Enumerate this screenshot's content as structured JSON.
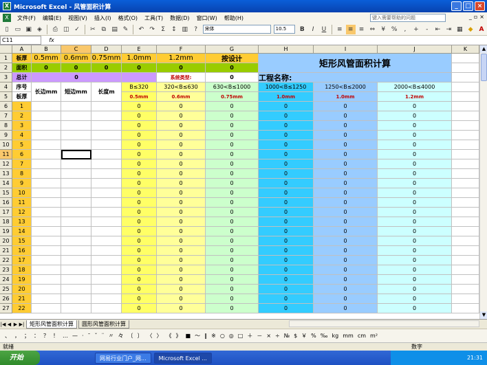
{
  "window": {
    "title": "Microsoft Excel - 风管面积计算"
  },
  "menu": {
    "items": [
      "文件(F)",
      "编辑(E)",
      "视图(V)",
      "插入(I)",
      "格式(O)",
      "工具(T)",
      "数据(D)",
      "窗口(W)",
      "帮助(H)"
    ],
    "help_placeholder": "键入需要帮助的问题"
  },
  "toolbar": {
    "font_name": "宋体",
    "font_size": "10.5"
  },
  "formula": {
    "cell_ref": "C11",
    "fx": "fx"
  },
  "columns": [
    "A",
    "B",
    "C",
    "D",
    "E",
    "F",
    "G",
    "H",
    "I",
    "J",
    "K"
  ],
  "sheet": {
    "r1": {
      "A": "板厚",
      "B": "0.5mm",
      "C": "0.6mm",
      "D": "0.75mm",
      "E": "1.0mm",
      "F": "1.2mm",
      "G": "按设计"
    },
    "r2": {
      "A": "面积",
      "B": "0",
      "C": "0",
      "D": "0",
      "E": "0",
      "F": "0",
      "G": "0"
    },
    "title": "矩形风管面积计算",
    "r3": {
      "A": "总计",
      "BD": "0",
      "F": "系统类型:",
      "G": "0",
      "H": "工程名称:"
    },
    "r4": {
      "A": "序号",
      "B": "长边mm",
      "C": "短边mm",
      "D": "长度m",
      "E": "B≤320",
      "F": "320<B≤630",
      "G": "630<B≤1000",
      "H": "1000<B≤1250",
      "I": "1250<B≤2000",
      "J": "2000<B≤4000"
    },
    "r5": {
      "A": "板厚",
      "E": "0.5mm",
      "F": "0.6mm",
      "G": "0.75mm",
      "H": "1.0mm",
      "I": "1.0mm",
      "J": "1.2mm"
    },
    "data_rows": [
      {
        "row": "6",
        "seq": "1"
      },
      {
        "row": "7",
        "seq": "2"
      },
      {
        "row": "8",
        "seq": "3"
      },
      {
        "row": "9",
        "seq": "4"
      },
      {
        "row": "10",
        "seq": "5"
      },
      {
        "row": "11",
        "seq": "6"
      },
      {
        "row": "12",
        "seq": "7"
      },
      {
        "row": "13",
        "seq": "8"
      },
      {
        "row": "14",
        "seq": "9"
      },
      {
        "row": "15",
        "seq": "10"
      },
      {
        "row": "16",
        "seq": "11"
      },
      {
        "row": "17",
        "seq": "12"
      },
      {
        "row": "18",
        "seq": "13"
      },
      {
        "row": "19",
        "seq": "14"
      },
      {
        "row": "20",
        "seq": "15"
      },
      {
        "row": "21",
        "seq": "16"
      },
      {
        "row": "22",
        "seq": "17"
      },
      {
        "row": "23",
        "seq": "18"
      },
      {
        "row": "24",
        "seq": "19"
      },
      {
        "row": "25",
        "seq": "20"
      },
      {
        "row": "26",
        "seq": "21"
      },
      {
        "row": "27",
        "seq": "22"
      }
    ],
    "zero": "0"
  },
  "tabs": [
    "矩形风管面积计算",
    "圆形风管面积计算"
  ],
  "symbols": [
    "、",
    "，",
    "；",
    "：",
    "？",
    "！",
    "…",
    "—",
    "·",
    "ˉ",
    "ˇ",
    "¨",
    "〃",
    "々",
    "〔",
    "〕",
    "〈",
    "〉",
    "《",
    "》",
    "■",
    "～",
    "‖",
    "※",
    "○",
    "◎",
    "□",
    "＋",
    "－",
    "×",
    "÷",
    "№",
    "$",
    "￥",
    "%",
    "‰",
    "kg",
    "mm",
    "cm",
    "m²"
  ],
  "status": {
    "left": "就绪",
    "right": "数字"
  },
  "taskbar": {
    "start": "开始",
    "tasks": [
      "网易行业门户_网...",
      "Microsoft Excel ..."
    ],
    "time": "21:31"
  },
  "colors": {
    "yellow": "#ffff66",
    "orange": "#ffcc33",
    "green": "#99cc00",
    "purple": "#cc99ff",
    "lightblue": "#99ccff",
    "lightyellow": "#ffff99",
    "lightgreen": "#ccffcc",
    "cyan": "#33ccff",
    "blue": "#99ccff",
    "lightcyan": "#ccffff"
  }
}
